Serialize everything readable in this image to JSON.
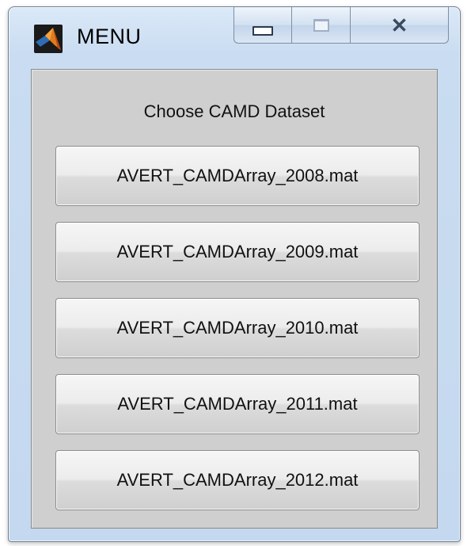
{
  "window": {
    "title": "MENU",
    "icon": "matlab-icon",
    "caption_buttons": {
      "minimize": "minimize-icon",
      "maximize": "maximize-icon",
      "close": "close-icon"
    }
  },
  "panel": {
    "heading": "Choose CAMD Dataset",
    "buttons": [
      {
        "label": "AVERT_CAMDArray_2008.mat"
      },
      {
        "label": "AVERT_CAMDArray_2009.mat"
      },
      {
        "label": "AVERT_CAMDArray_2010.mat"
      },
      {
        "label": "AVERT_CAMDArray_2011.mat"
      },
      {
        "label": "AVERT_CAMDArray_2012.mat"
      }
    ]
  }
}
